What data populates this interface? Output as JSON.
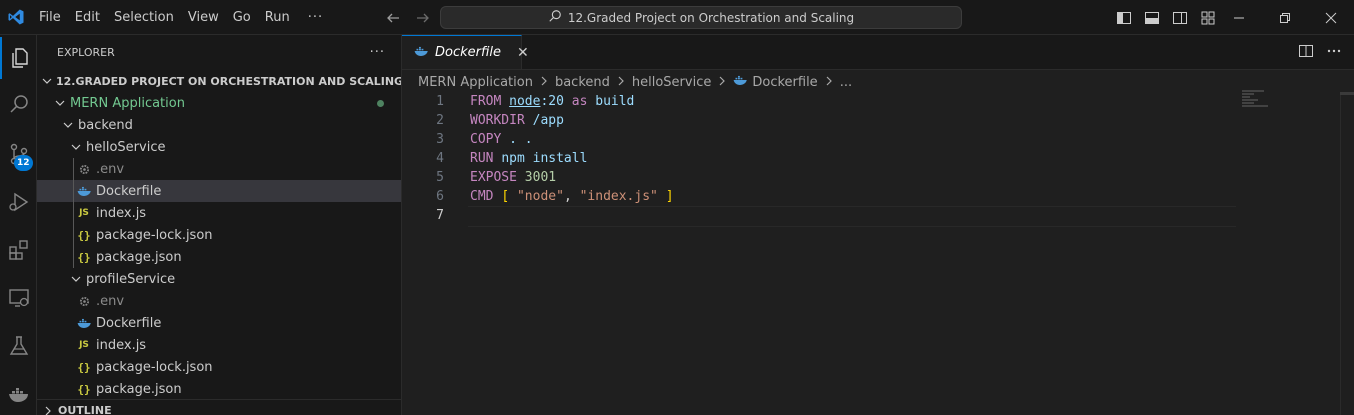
{
  "titlebar": {
    "menu": [
      "File",
      "Edit",
      "Selection",
      "View",
      "Go",
      "Run",
      "···"
    ],
    "search_text": "12.Graded Project on Orchestration and Scaling"
  },
  "activity": {
    "scm_badge": "12"
  },
  "explorer": {
    "header": "EXPLORER",
    "more": "···",
    "workspace": "12.GRADED PROJECT ON ORCHESTRATION AND SCALING",
    "items": [
      {
        "label": "MERN Application",
        "icon": "chevron-down",
        "depth": 1,
        "type": "folder-git"
      },
      {
        "label": "backend",
        "icon": "chevron-down",
        "depth": 2,
        "type": "folder"
      },
      {
        "label": "helloService",
        "icon": "chevron-down",
        "depth": 3,
        "type": "folder"
      },
      {
        "label": ".env",
        "icon": "gear",
        "depth": 4,
        "type": "env"
      },
      {
        "label": "Dockerfile",
        "icon": "docker",
        "depth": 4,
        "type": "docker",
        "selected": true
      },
      {
        "label": "index.js",
        "icon": "js",
        "depth": 4,
        "type": "js"
      },
      {
        "label": "package-lock.json",
        "icon": "json",
        "depth": 4,
        "type": "json"
      },
      {
        "label": "package.json",
        "icon": "json",
        "depth": 4,
        "type": "json"
      },
      {
        "label": "profileService",
        "icon": "chevron-down",
        "depth": 3,
        "type": "folder"
      },
      {
        "label": ".env",
        "icon": "gear",
        "depth": 4,
        "type": "env"
      },
      {
        "label": "Dockerfile",
        "icon": "docker",
        "depth": 4,
        "type": "docker"
      },
      {
        "label": "index.js",
        "icon": "js",
        "depth": 4,
        "type": "js"
      },
      {
        "label": "package-lock.json",
        "icon": "json",
        "depth": 4,
        "type": "json"
      },
      {
        "label": "package.json",
        "icon": "json",
        "depth": 4,
        "type": "json"
      }
    ],
    "outline": "OUTLINE",
    "js_glyph": "JS",
    "json_glyph": "{}"
  },
  "editor": {
    "tab_label": "Dockerfile",
    "tab_close": "✕",
    "breadcrumbs": [
      "MERN Application",
      "backend",
      "helloService",
      "Dockerfile",
      "..."
    ],
    "line_numbers": [
      "1",
      "2",
      "3",
      "4",
      "5",
      "6",
      "7"
    ],
    "code_lines": [
      "FROM node:20 as build",
      "WORKDIR /app",
      "COPY . .",
      "RUN npm install",
      "EXPOSE 3001",
      "CMD [ \"node\", \"index.js\" ]",
      ""
    ],
    "active_line": 7
  },
  "colors": {
    "accent": "#0078d4",
    "git_added": "#73c991",
    "docker_blue": "#4d9ad8"
  }
}
